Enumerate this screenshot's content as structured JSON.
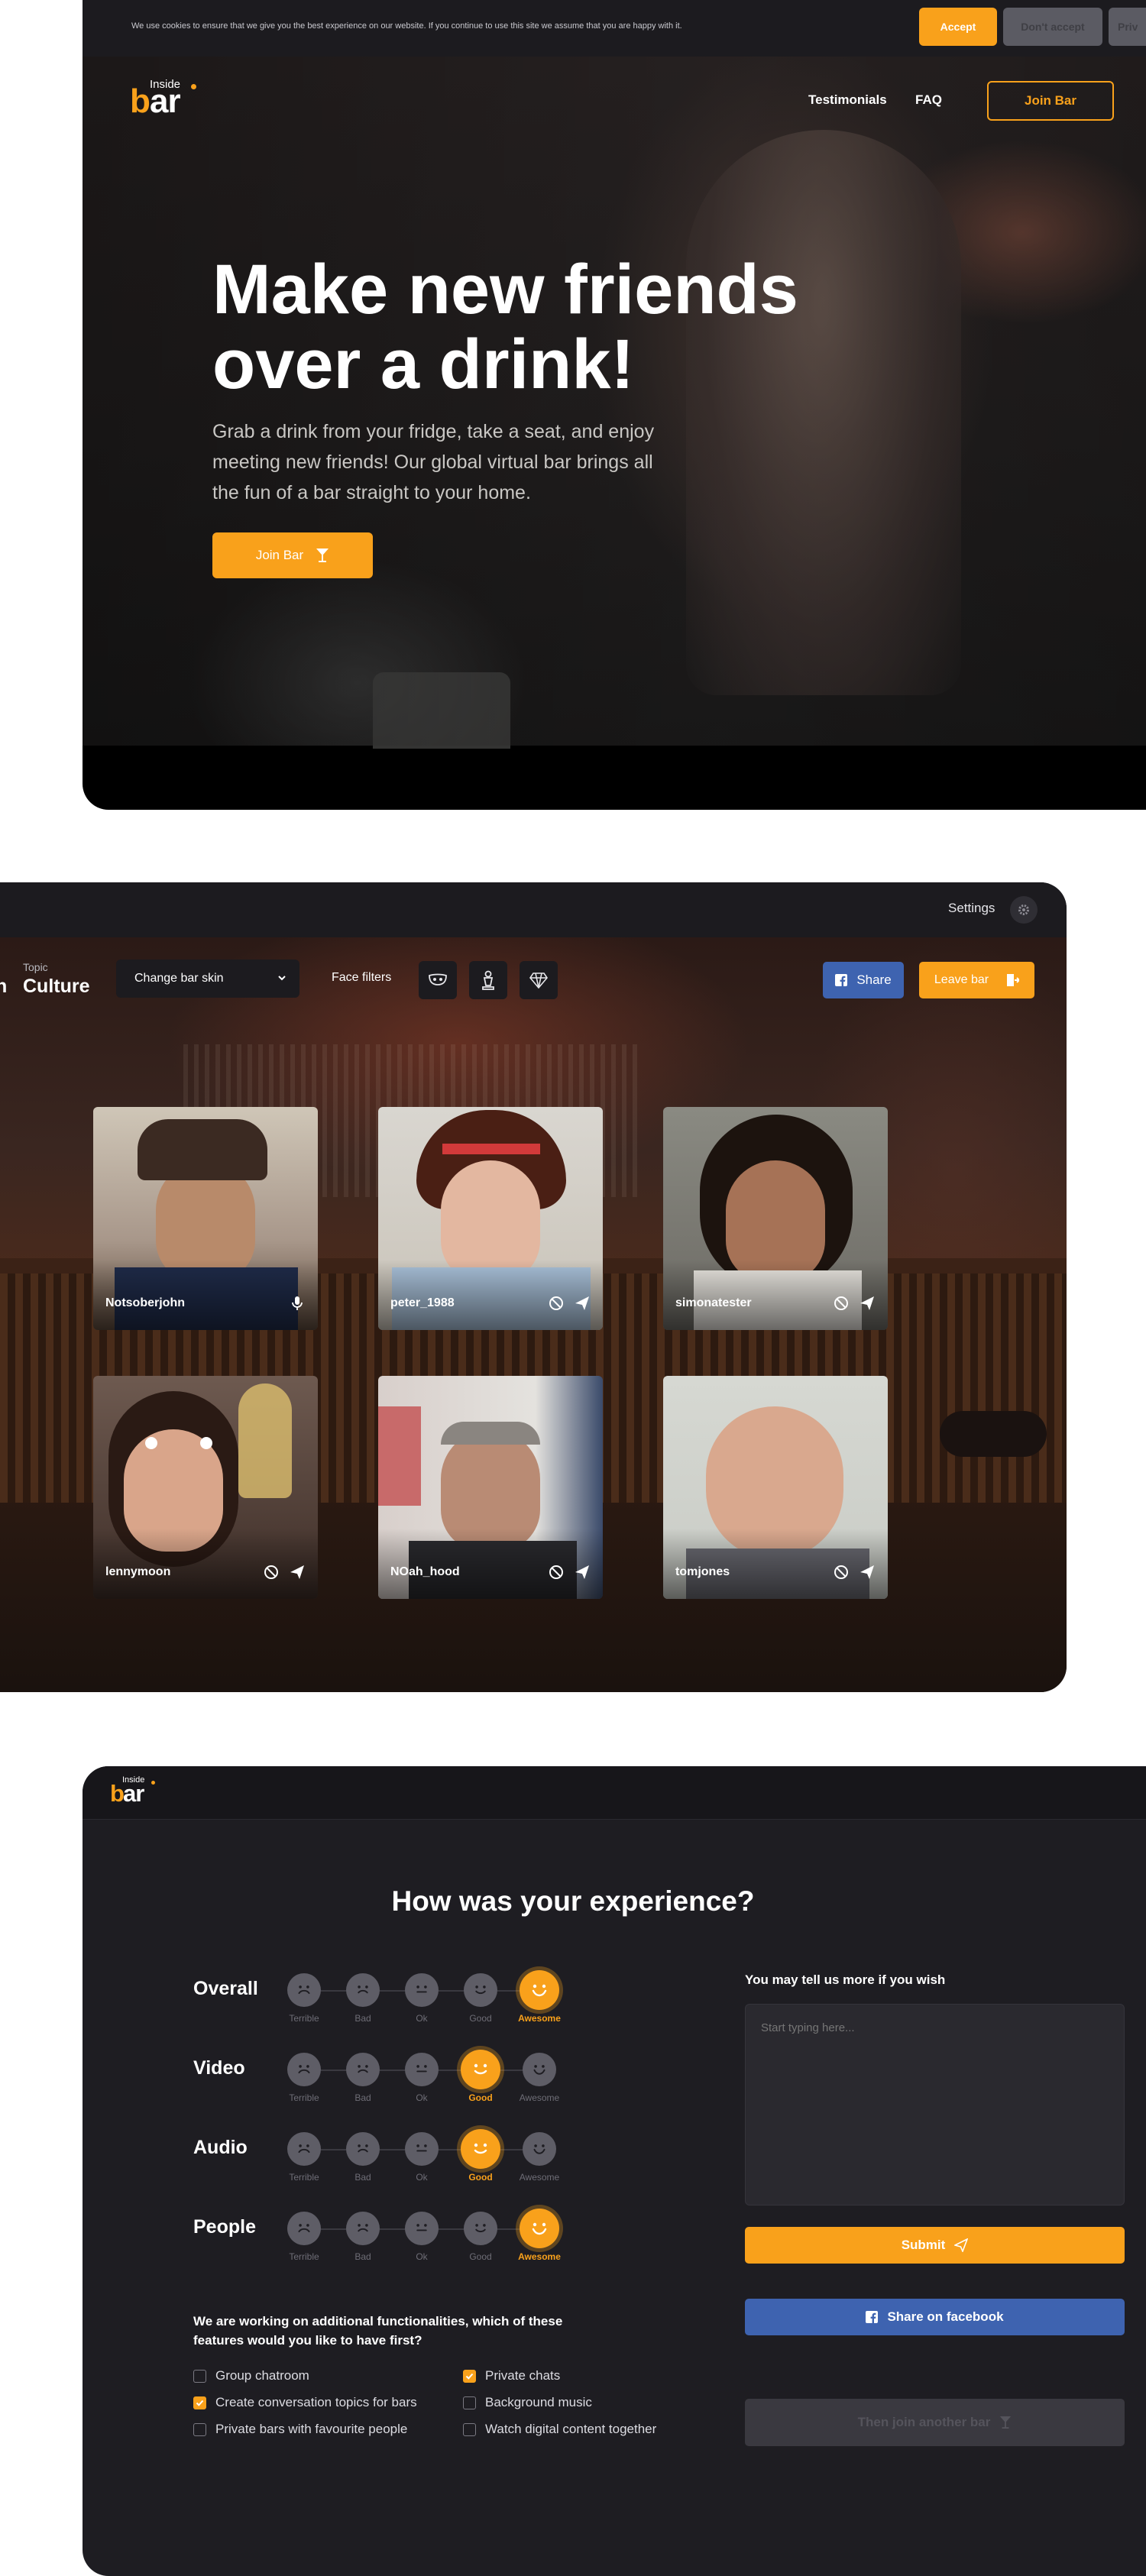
{
  "brand": {
    "small": "Inside",
    "big": "bar"
  },
  "cookie": {
    "text": "We use cookies to ensure that we give you the best experience on our website. If you continue to use this site we assume that you are happy with it.",
    "accept": "Accept",
    "dont_accept": "Don't accept",
    "privacy": "Priv"
  },
  "nav": {
    "testimonials": "Testimonials",
    "faq": "FAQ",
    "join": "Join Bar"
  },
  "hero": {
    "title_line1": "Make new friends",
    "title_line2": "over a drink!",
    "subtitle": "Grab a drink from your fridge, take a seat, and enjoy meeting new friends!  Our global virtual bar brings all the fun of a bar straight to your home.",
    "join": "Join Bar"
  },
  "room": {
    "settings": "Settings",
    "topic_small": "Topic",
    "topic": "Culture",
    "topic_cut": "n",
    "skin_select": "Change bar skin",
    "face_filters": "Face filters",
    "filter_icons": [
      "mask-icon",
      "statue-icon",
      "gem-icon"
    ],
    "share": "Share",
    "leave": "Leave bar",
    "participants": [
      {
        "name": "Notsoberjohn",
        "icons": [
          "microphone-icon"
        ]
      },
      {
        "name": "peter_1988",
        "icons": [
          "block-icon",
          "send-icon"
        ]
      },
      {
        "name": "simonatester",
        "icons": [
          "block-icon",
          "send-icon"
        ]
      },
      {
        "name": "lennymoon",
        "icons": [
          "block-icon",
          "send-icon"
        ]
      },
      {
        "name": "NOah_hood",
        "icons": [
          "block-icon",
          "send-icon"
        ]
      },
      {
        "name": "tomjones",
        "icons": [
          "block-icon",
          "send-icon"
        ]
      }
    ]
  },
  "feedback": {
    "title": "How was your experience?",
    "scale": [
      "Terrible",
      "Bad",
      "Ok",
      "Good",
      "Awesome"
    ],
    "categories": [
      {
        "label": "Overall",
        "selected": "Awesome"
      },
      {
        "label": "Video",
        "selected": "Good"
      },
      {
        "label": "Audio",
        "selected": "Good"
      },
      {
        "label": "People",
        "selected": "Awesome"
      }
    ],
    "question": "We are working on additional functionalities, which of these features would you like to have first?",
    "options": [
      {
        "label": "Group chatroom",
        "checked": false
      },
      {
        "label": "Create conversation topics for bars",
        "checked": true
      },
      {
        "label": "Private bars with favourite people",
        "checked": false
      },
      {
        "label": "Private chats",
        "checked": true
      },
      {
        "label": "Background music",
        "checked": false
      },
      {
        "label": "Watch digital content together",
        "checked": false
      }
    ],
    "tell_label": "You may tell us more if you wish",
    "tell_placeholder": "Start typing here...",
    "submit": "Submit",
    "share_facebook": "Share on facebook",
    "another": "Then join another bar"
  },
  "colors": {
    "accent": "#f9a11b",
    "facebook": "#3e63b0",
    "dark": "#1e1d22"
  }
}
